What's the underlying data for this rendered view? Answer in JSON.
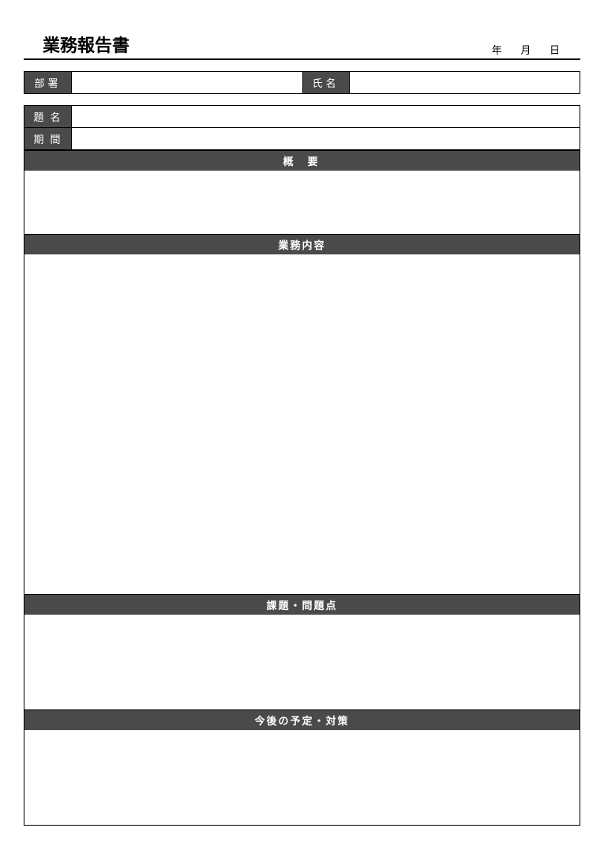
{
  "title": "業務報告書",
  "date": {
    "year_label": "年",
    "month_label": "月",
    "day_label": "日"
  },
  "info": {
    "dept_label": "部署",
    "dept_value": "",
    "name_label": "氏名",
    "name_value": ""
  },
  "fields": {
    "subject_label": "題名",
    "subject_value": "",
    "period_label": "期間",
    "period_value": ""
  },
  "sections": {
    "summary_label": "概要",
    "summary_value": "",
    "content_label": "業務内容",
    "content_value": "",
    "issues_label": "課題・問題点",
    "issues_value": "",
    "plan_label": "今後の予定・対策",
    "plan_value": ""
  }
}
